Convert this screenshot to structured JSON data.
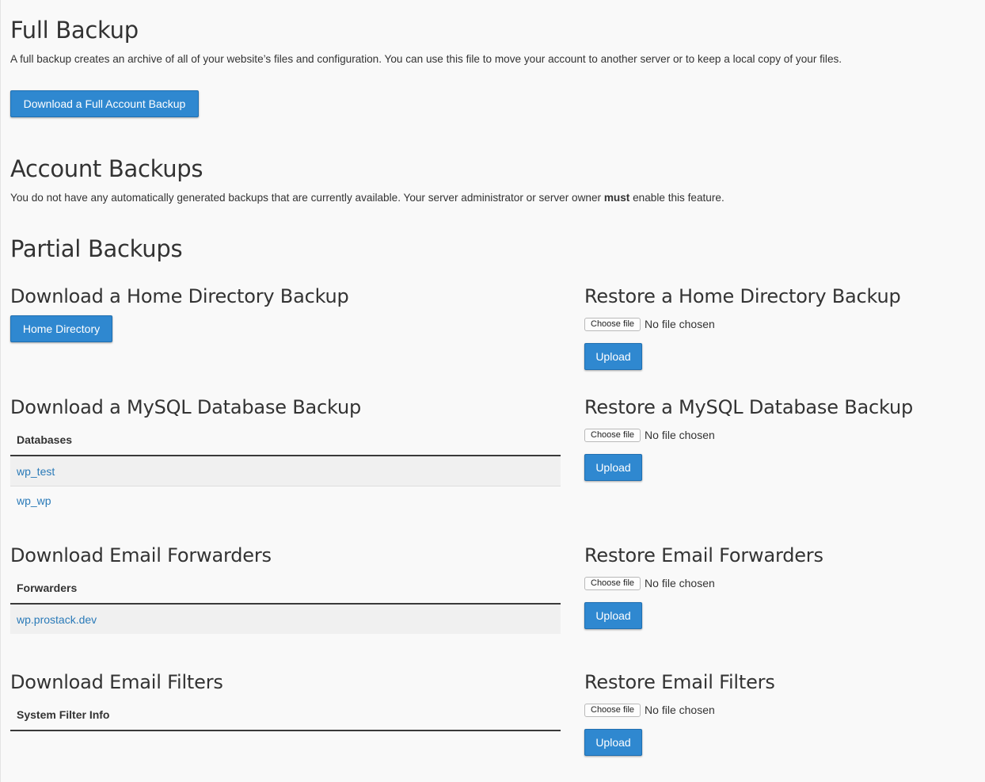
{
  "full_backup": {
    "title": "Full Backup",
    "description": "A full backup creates an archive of all of your website’s files and configuration. You can use this file to move your account to another server or to keep a local copy of your files.",
    "button_label": "Download a Full Account Backup"
  },
  "account_backups": {
    "title": "Account Backups",
    "description_before": "You do not have any automatically generated backups that are currently available. Your server administrator or server owner ",
    "description_bold": "must",
    "description_after": " enable this feature."
  },
  "partial_backups": {
    "title": "Partial Backups",
    "home_directory": {
      "download_title": "Download a Home Directory Backup",
      "download_button": "Home Directory",
      "restore_title": "Restore a Home Directory Backup",
      "choose_file_label": "Choose file",
      "no_file_text": "No file chosen",
      "upload_label": "Upload"
    },
    "mysql": {
      "download_title": "Download a MySQL Database Backup",
      "table_header": "Databases",
      "databases": [
        "wp_test",
        "wp_wp"
      ],
      "restore_title": "Restore a MySQL Database Backup",
      "choose_file_label": "Choose file",
      "no_file_text": "No file chosen",
      "upload_label": "Upload"
    },
    "email_forwarders": {
      "download_title": "Download Email Forwarders",
      "table_header": "Forwarders",
      "forwarders": [
        "wp.prostack.dev"
      ],
      "restore_title": "Restore Email Forwarders",
      "choose_file_label": "Choose file",
      "no_file_text": "No file chosen",
      "upload_label": "Upload"
    },
    "email_filters": {
      "download_title": "Download Email Filters",
      "table_header": "System Filter Info",
      "restore_title": "Restore Email Filters",
      "choose_file_label": "Choose file",
      "no_file_text": "No file chosen",
      "upload_label": "Upload"
    }
  },
  "colors": {
    "primary_button": "#2f88d0",
    "link": "#2a7ab8",
    "background": "#f9f9f9"
  }
}
